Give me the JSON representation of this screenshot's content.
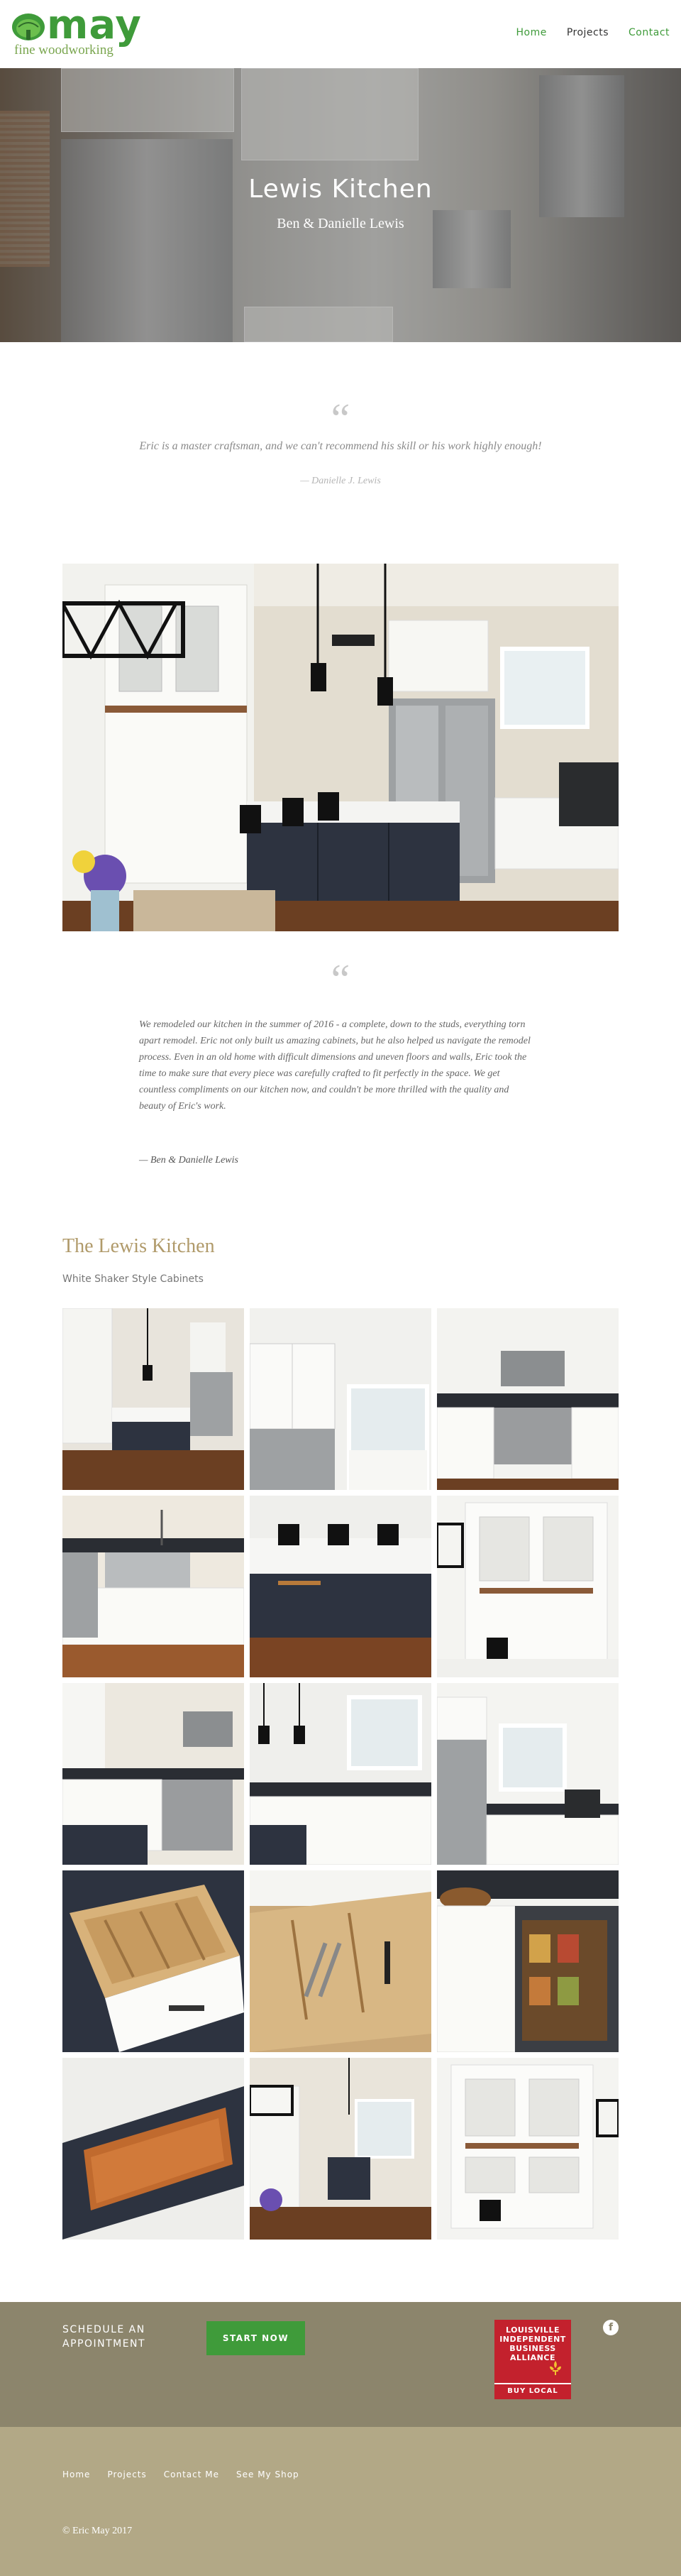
{
  "header": {
    "logo_word": "may",
    "logo_sub": "fine woodworking",
    "nav": [
      {
        "label": "Home"
      },
      {
        "label": "Projects"
      },
      {
        "label": "Contact"
      }
    ]
  },
  "hero": {
    "title": "Lewis Kitchen",
    "subtitle": "Ben & Danielle Lewis"
  },
  "testimonial_1": {
    "quote_mark": "“",
    "text": "Eric is a master craftsman, and we can't recommend his skill or his work highly enough!",
    "author": "— Danielle J. Lewis"
  },
  "testimonial_2": {
    "quote_mark": "“",
    "text": "We remodeled our kitchen in the summer of 2016 - a complete, down to the studs, everything torn apart remodel. Eric not only built us amazing cabinets, but he also helped us navigate the remodel process.  Even in an old home with difficult dimensions and uneven floors and walls, Eric took the time to make sure that every piece was carefully crafted to fit perfectly in the space. We get countless compliments on our kitchen now, and couldn't be more thrilled with the quality and beauty of Eric's work.",
    "author": "— Ben & Danielle Lewis"
  },
  "gallery": {
    "title": "The Lewis Kitchen",
    "subtitle": "White Shaker Style Cabinets"
  },
  "cta": {
    "label": "SCHEDULE AN APPOINTMENT",
    "button": "START NOW"
  },
  "badge": {
    "line1": "LOUISVILLE",
    "line2": "INDEPENDENT",
    "line3": "BUSINESS",
    "line4": "ALLIANCE",
    "buy": "BUY LOCAL"
  },
  "social": {
    "facebook": "f"
  },
  "footer": {
    "nav": [
      {
        "label": "Home"
      },
      {
        "label": "Projects"
      },
      {
        "label": "Contact Me"
      },
      {
        "label": "See My Shop"
      }
    ],
    "copyright": "© Eric May 2017"
  },
  "colors": {
    "brand_green": "#3f9b3a",
    "gold_title": "#b09a6a",
    "band_dark": "#8c856c",
    "band_light": "#b2a886",
    "badge_red": "#c3212d"
  },
  "icons": [
    "tree-logo-icon",
    "quote-icon",
    "fleur-de-lis-icon",
    "facebook-icon"
  ]
}
